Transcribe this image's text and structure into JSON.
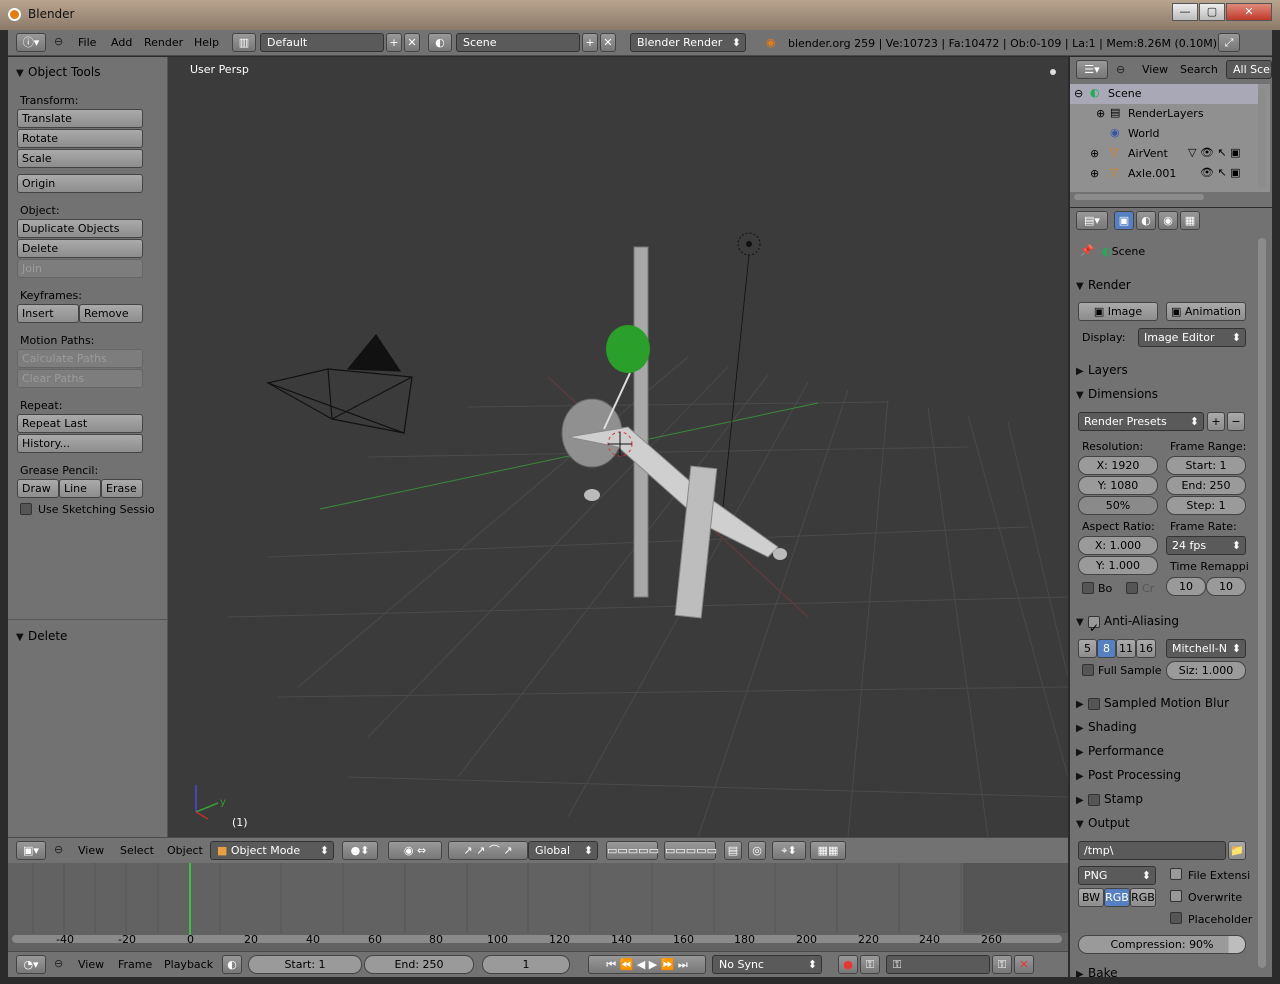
{
  "window": {
    "title": "Blender"
  },
  "top_header": {
    "menus": [
      "File",
      "Add",
      "Render",
      "Help"
    ],
    "screen_layout": "Default",
    "scene": "Scene",
    "render_engine": "Blender Render",
    "status": "blender.org 259 | Ve:10723 | Fa:10472 | Ob:0-109 | La:1 | Mem:8.26M (0.10M)"
  },
  "tool_panel": {
    "title": "Object Tools",
    "transform_label": "Transform:",
    "translate": "Translate",
    "rotate": "Rotate",
    "scale": "Scale",
    "origin": "Origin",
    "object_label": "Object:",
    "duplicate": "Duplicate Objects",
    "delete": "Delete",
    "join": "Join",
    "keyframes_label": "Keyframes:",
    "insert": "Insert",
    "remove": "Remove",
    "motion_paths_label": "Motion Paths:",
    "calculate_paths": "Calculate Paths",
    "clear_paths": "Clear Paths",
    "repeat_label": "Repeat:",
    "repeat_last": "Repeat Last",
    "history": "History...",
    "grease_label": "Grease Pencil:",
    "draw": "Draw",
    "line": "Line",
    "erase": "Erase",
    "use_sketching": "Use Sketching Sessio",
    "delete_panel": "Delete"
  },
  "viewport": {
    "view_name": "User Persp",
    "frame_indicator": "(1)",
    "axis_y": "y"
  },
  "viewport_header": {
    "menus": [
      "View",
      "Select",
      "Object"
    ],
    "mode": "Object Mode",
    "orientation": "Global"
  },
  "timeline": {
    "ticks": [
      "-40",
      "-20",
      "0",
      "20",
      "40",
      "60",
      "80",
      "100",
      "120",
      "140",
      "160",
      "180",
      "200",
      "220",
      "240",
      "260"
    ],
    "menus": [
      "View",
      "Frame",
      "Playback"
    ],
    "start": "Start: 1",
    "end": "End: 250",
    "current": "1",
    "sync": "No Sync"
  },
  "outliner": {
    "menus": [
      "View",
      "Search"
    ],
    "filter": "All Scen",
    "items": [
      "Scene",
      "RenderLayers",
      "World",
      "AirVent",
      "Axle.001"
    ]
  },
  "properties": {
    "context": "Scene",
    "render_section": "Render",
    "image_btn": "Image",
    "animation_btn": "Animation",
    "display_label": "Display:",
    "display_value": "Image Editor",
    "layers": "Layers",
    "dimensions": "Dimensions",
    "render_presets": "Render Presets",
    "resolution_label": "Resolution:",
    "res_x": "X: 1920",
    "res_y": "Y: 1080",
    "res_pct": "50%",
    "frame_range_label": "Frame Range:",
    "start": "Start: 1",
    "end": "End: 250",
    "step": "Step: 1",
    "aspect_label": "Aspect Ratio:",
    "aspect_x": "X: 1.000",
    "aspect_y": "Y: 1.000",
    "frame_rate_label": "Frame Rate:",
    "fps": "24 fps",
    "time_remap_label": "Time Remappi",
    "remap_old": "10",
    "remap_new": "10",
    "border": "Bo",
    "crop": "Cr",
    "anti_aliasing": "Anti-Aliasing",
    "aa_samples": [
      "5",
      "8",
      "11",
      "16"
    ],
    "aa_filter": "Mitchell-N",
    "full_sample": "Full Sample",
    "aa_size": "Siz: 1.000",
    "motion_blur": "Sampled Motion Blur",
    "shading": "Shading",
    "performance": "Performance",
    "post_processing": "Post Processing",
    "stamp": "Stamp",
    "output": "Output",
    "output_path": "/tmp\\",
    "file_format": "PNG",
    "file_ext": "File Extensi",
    "overwrite": "Overwrite",
    "placeholder": "Placeholder",
    "color_modes": [
      "BW",
      "RGB",
      "RGB"
    ],
    "compression": "Compression: 90%",
    "bake": "Bake"
  },
  "colors": {
    "accent_blue": "#5680c2",
    "grid_green": "#3a8a3a",
    "grid_red": "#8a3a3a",
    "current_frame": "#40c040"
  }
}
